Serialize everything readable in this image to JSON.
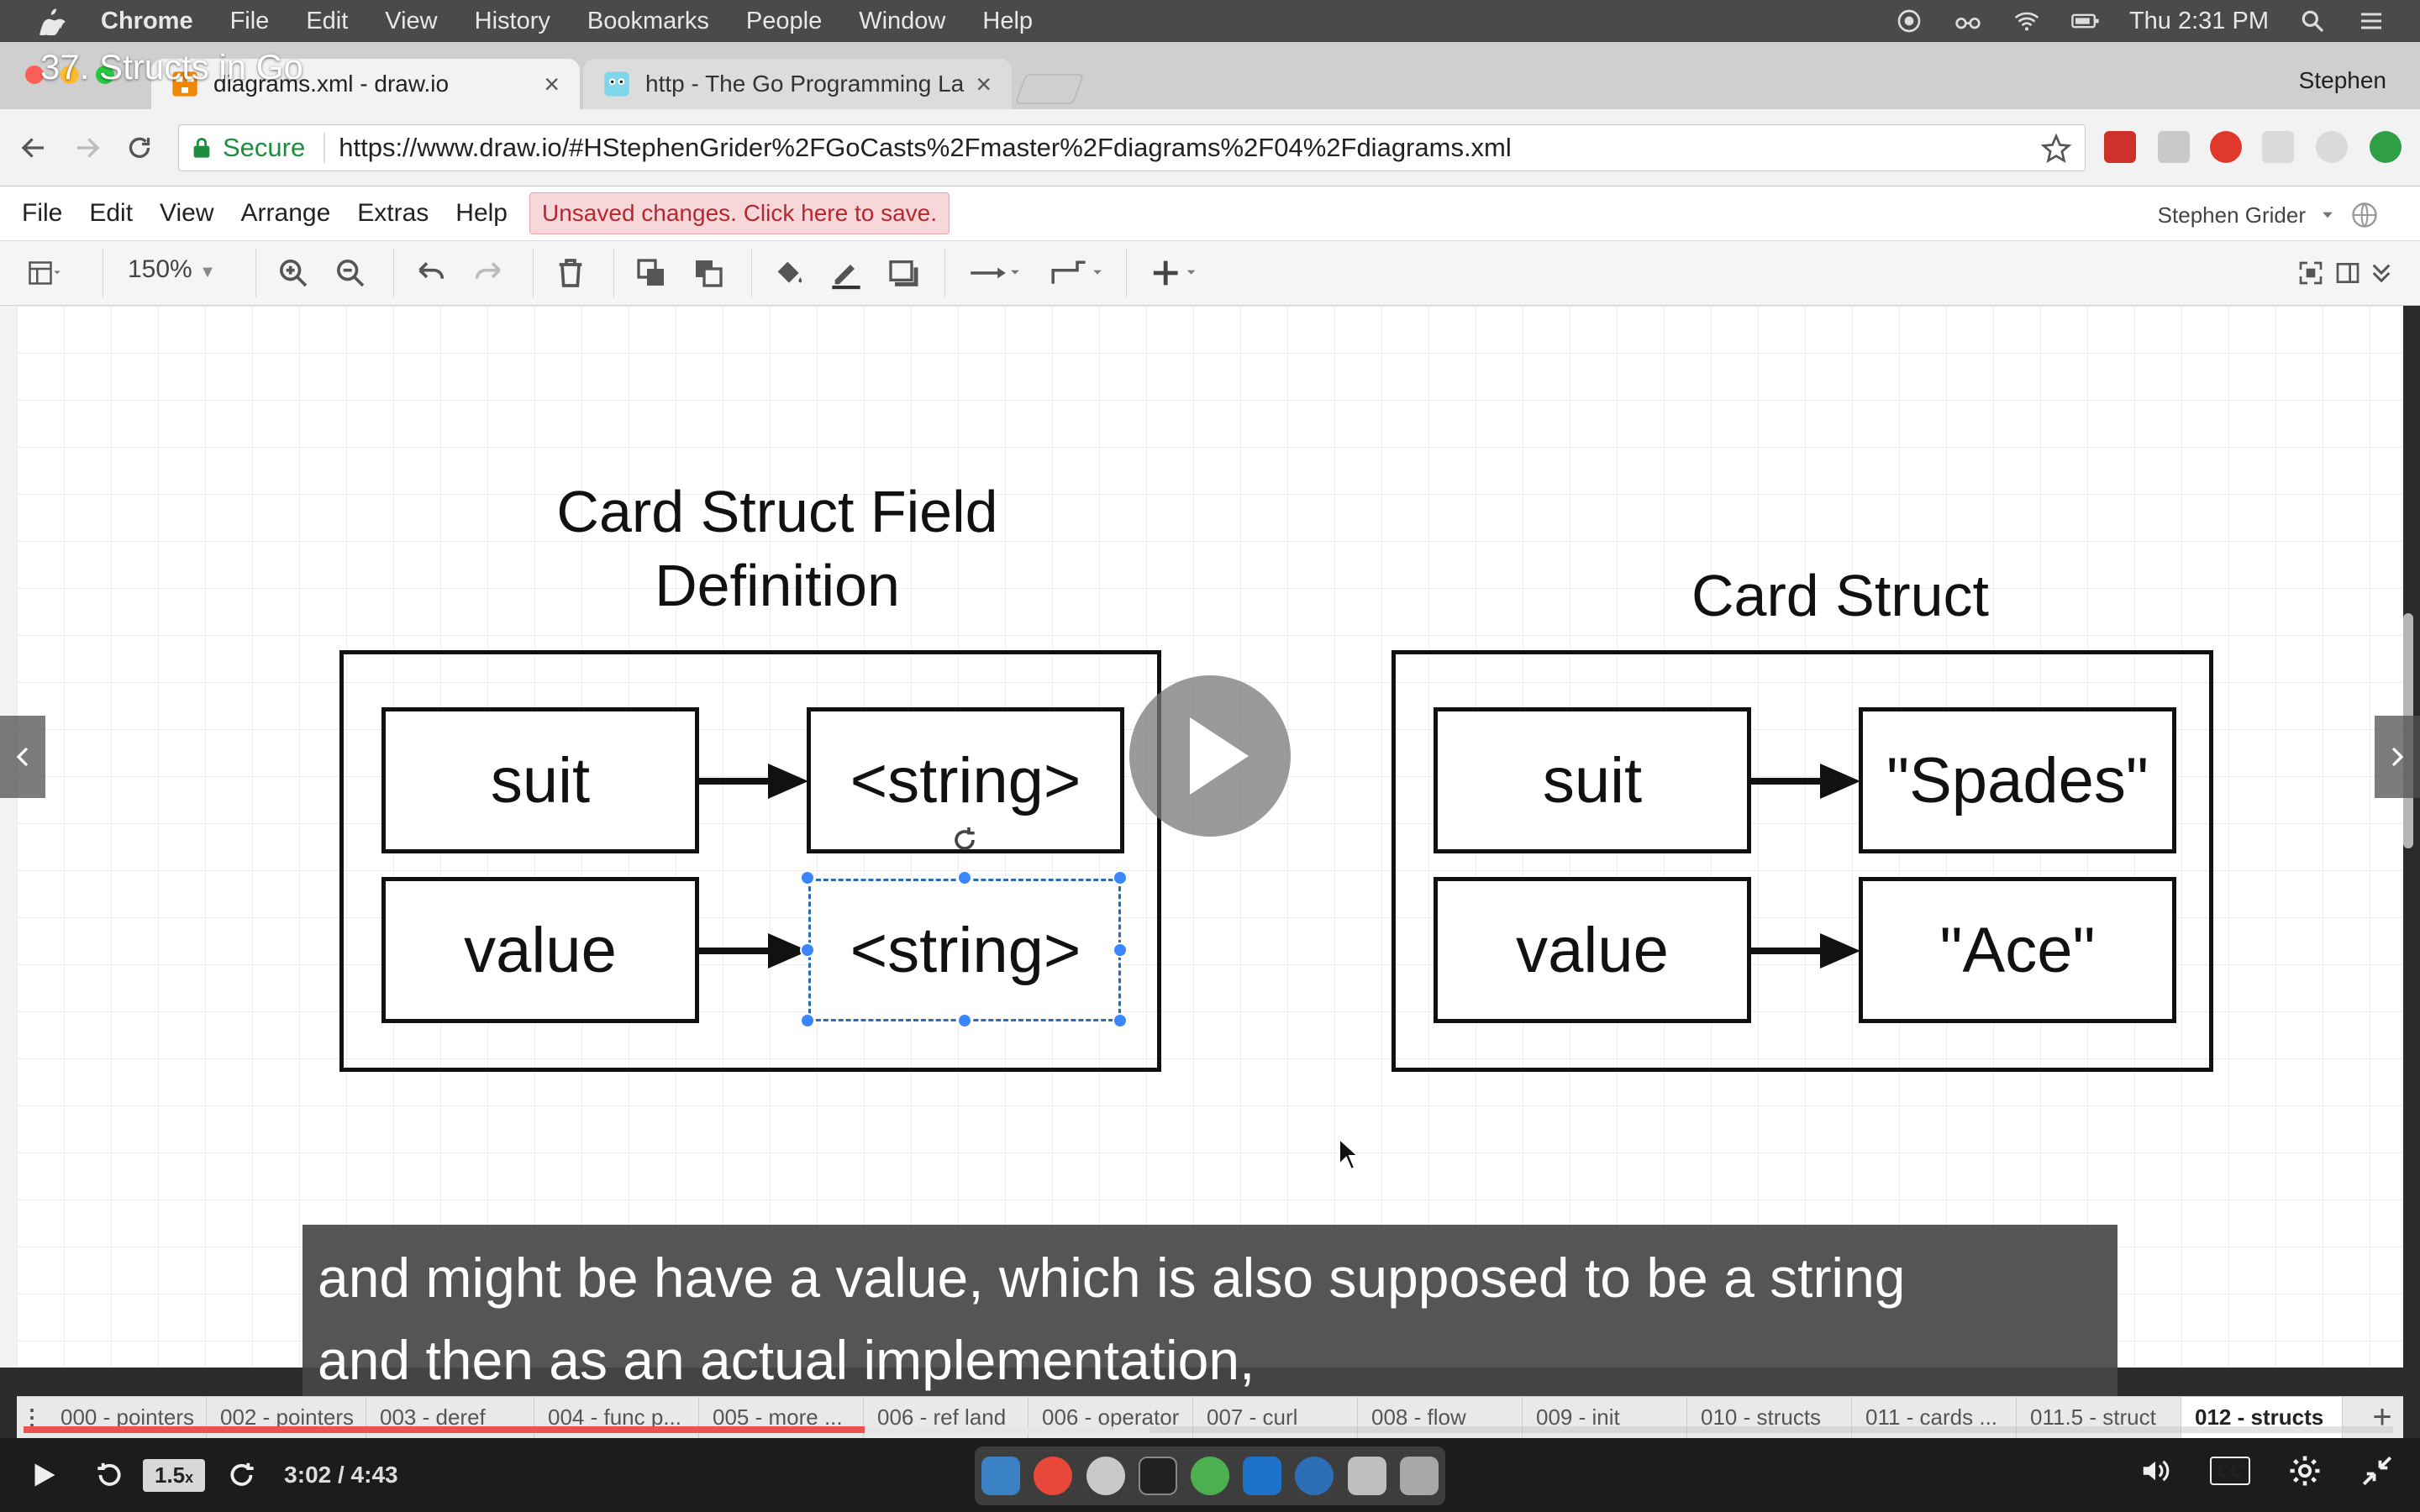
{
  "video": {
    "title": "37. Structs in Go",
    "subtitle_line1": "and might be have a value, which is also supposed to be a string",
    "subtitle_line2": "and then as an actual implementation,",
    "speed": "1.5",
    "speed_suffix": "x",
    "timecode": "3:02 / 4:43",
    "progress": 0.355,
    "buffered": 0.475,
    "cc_label": "CC"
  },
  "os_menu": {
    "app_name": "Chrome",
    "items": [
      "File",
      "Edit",
      "View",
      "History",
      "Bookmarks",
      "People",
      "Window",
      "Help"
    ],
    "clock": "Thu 2:31 PM"
  },
  "browser": {
    "tabs": [
      {
        "label": "diagrams.xml - draw.io",
        "active": true
      },
      {
        "label": "http - The Go Programming La",
        "active": false
      }
    ],
    "profile": "Stephen",
    "secure_label": "Secure",
    "url": "https://www.draw.io/#HStephenGrider%2FGoCasts%2Fmaster%2Fdiagrams%2F04%2Fdiagrams.xml"
  },
  "drawio": {
    "menu": [
      "File",
      "Edit",
      "View",
      "Arrange",
      "Extras",
      "Help"
    ],
    "unsaved": "Unsaved changes. Click here to save.",
    "user": "Stephen Grider",
    "zoom": "150%",
    "diagram": {
      "left": {
        "title_line1": "Card Struct Field",
        "title_line2": "Definition",
        "rows": [
          {
            "key": "suit",
            "value": "<string>"
          },
          {
            "key": "value",
            "value": "<string>"
          }
        ]
      },
      "right": {
        "title": "Card Struct",
        "rows": [
          {
            "key": "suit",
            "value": "\"Spades\""
          },
          {
            "key": "value",
            "value": "\"Ace\""
          }
        ]
      }
    },
    "sheets": [
      "000 - pointers",
      "002 - pointers",
      "003 - deref",
      "004 - func p...",
      "005 - more ...",
      "006 - ref land",
      "006 - operator",
      "007 - curl",
      "008 - flow",
      "009 - init",
      "010 - structs",
      "011 - cards ...",
      "011.5 - struct",
      "012 - structs"
    ],
    "active_sheet": "012 - structs"
  },
  "colors": {
    "accent_red": "#ec5252",
    "selection_blue": "#3a86ff",
    "secure_green": "#1e8e3e",
    "unsaved_bg": "#f8d7da"
  }
}
